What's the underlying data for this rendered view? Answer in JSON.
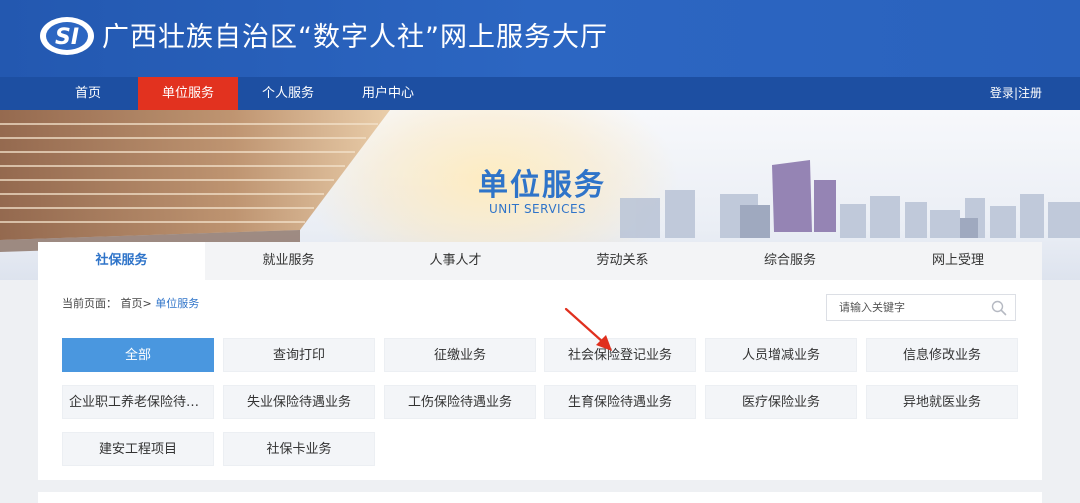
{
  "header": {
    "title": "广西壮族自治区“数字人社”网上服务大厅",
    "logo_icon": "si-logo-icon"
  },
  "nav": {
    "items": [
      {
        "label": "首页"
      },
      {
        "label": "单位服务"
      },
      {
        "label": "个人服务"
      },
      {
        "label": "用户中心"
      }
    ],
    "active_index": 1,
    "login": "登录",
    "separator": "|",
    "register": "注册"
  },
  "banner": {
    "title": "单位服务",
    "subtitle": "UNIT SERVICES"
  },
  "tabs": [
    {
      "label": "社保服务"
    },
    {
      "label": "就业服务"
    },
    {
      "label": "人事人才"
    },
    {
      "label": "劳动关系"
    },
    {
      "label": "综合服务"
    },
    {
      "label": "网上受理"
    }
  ],
  "breadcrumb": {
    "prefix": "当前页面：",
    "home": "首页>",
    "current": "单位服务"
  },
  "search": {
    "placeholder": "请输入关键字"
  },
  "categories": [
    {
      "label": "全部"
    },
    {
      "label": "查询打印"
    },
    {
      "label": "征缴业务"
    },
    {
      "label": "社会保险登记业务"
    },
    {
      "label": "人员增减业务"
    },
    {
      "label": "信息修改业务"
    },
    {
      "label": "企业职工养老保险待遇业务"
    },
    {
      "label": "失业保险待遇业务"
    },
    {
      "label": "工伤保险待遇业务"
    },
    {
      "label": "生育保险待遇业务"
    },
    {
      "label": "医疗保险业务"
    },
    {
      "label": "异地就医业务"
    },
    {
      "label": "建安工程项目"
    },
    {
      "label": "社保卡业务"
    }
  ],
  "colors": {
    "header_blue": "#2c66c2",
    "nav_blue": "#1d4fa2",
    "active_red": "#e2321f",
    "accent_blue": "#2f74c9",
    "active_button": "#4a97df",
    "arrow_red": "#e0301e"
  }
}
